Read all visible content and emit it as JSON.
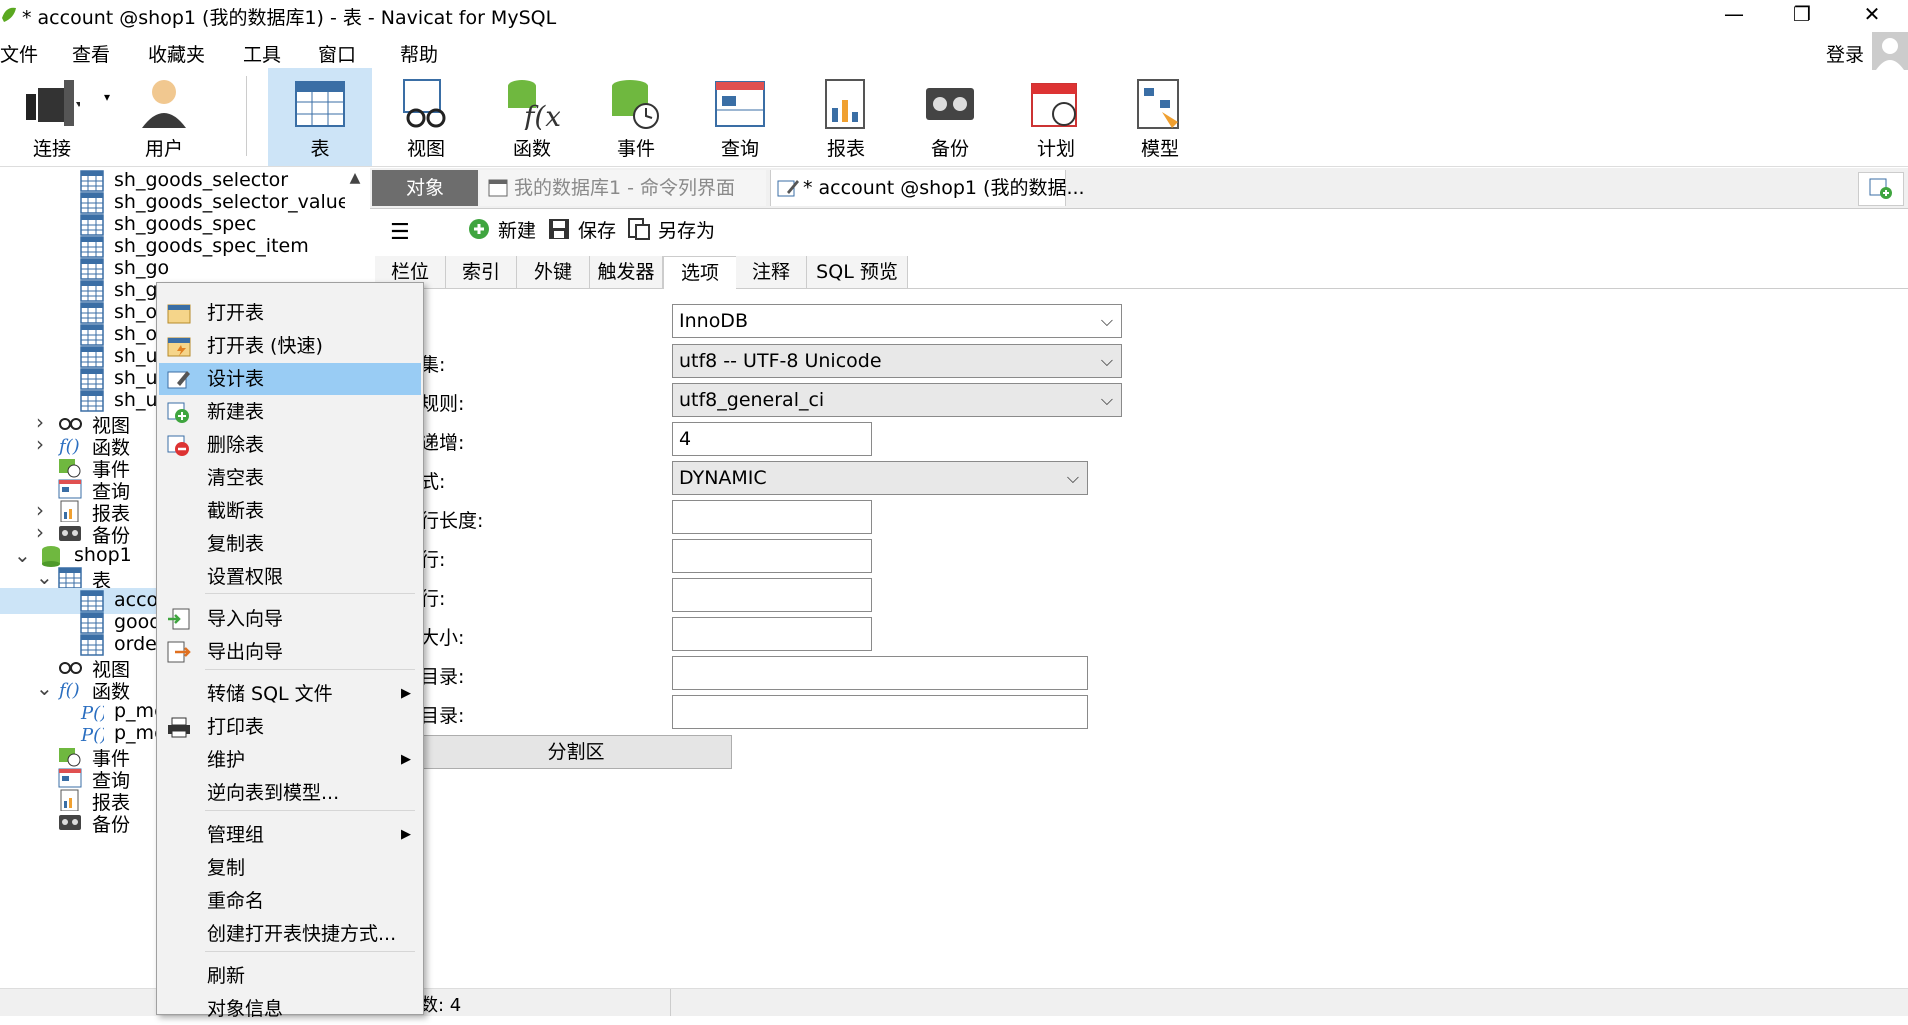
{
  "window": {
    "title": "* account @shop1 (我的数据库1) - 表 - Navicat for MySQL",
    "minimize": "—",
    "maximize": "❐",
    "close": "✕"
  },
  "menubar": {
    "items": [
      "文件",
      "查看",
      "收藏夹",
      "工具",
      "窗口",
      "帮助"
    ],
    "login": "登录"
  },
  "toolbar": {
    "items": [
      {
        "label": "连接",
        "icon": "plug-icon"
      },
      {
        "label": "用户",
        "icon": "user-icon"
      },
      {
        "label": "表",
        "icon": "table-icon"
      },
      {
        "label": "视图",
        "icon": "view-icon"
      },
      {
        "label": "函数",
        "icon": "function-icon"
      },
      {
        "label": "事件",
        "icon": "event-icon"
      },
      {
        "label": "查询",
        "icon": "query-icon"
      },
      {
        "label": "报表",
        "icon": "report-icon"
      },
      {
        "label": "备份",
        "icon": "backup-icon"
      },
      {
        "label": "计划",
        "icon": "schedule-icon"
      },
      {
        "label": "模型",
        "icon": "model-icon"
      }
    ]
  },
  "tree": {
    "items": [
      {
        "label": "sh_goods_selector",
        "icon": "table-icon"
      },
      {
        "label": "sh_goods_selector_value",
        "icon": "table-icon"
      },
      {
        "label": "sh_goods_spec",
        "icon": "table-icon"
      },
      {
        "label": "sh_goods_spec_item",
        "icon": "table-icon"
      },
      {
        "label": "sh_go",
        "icon": "table-icon"
      },
      {
        "label": "sh_go",
        "icon": "table-icon"
      },
      {
        "label": "sh_or",
        "icon": "table-icon"
      },
      {
        "label": "sh_or",
        "icon": "table-icon"
      },
      {
        "label": "sh_us",
        "icon": "table-icon"
      },
      {
        "label": "sh_us",
        "icon": "table-icon"
      },
      {
        "label": "sh_us",
        "icon": "table-icon"
      },
      {
        "label": "视图",
        "icon": "view-icon"
      },
      {
        "label": "函数",
        "icon": "function-icon"
      },
      {
        "label": "事件",
        "icon": "event-icon"
      },
      {
        "label": "查询",
        "icon": "query-icon"
      },
      {
        "label": "报表",
        "icon": "report-icon"
      },
      {
        "label": "备份",
        "icon": "backup-icon"
      },
      {
        "label": "shop1",
        "icon": "database-icon"
      },
      {
        "label": "表",
        "icon": "table-icon"
      },
      {
        "label": "acco",
        "icon": "table-icon"
      },
      {
        "label": "good",
        "icon": "table-icon"
      },
      {
        "label": "orde",
        "icon": "table-icon"
      },
      {
        "label": "视图",
        "icon": "view-icon"
      },
      {
        "label": "函数",
        "icon": "function-icon"
      },
      {
        "label": "p_mo",
        "icon": "procedure-icon"
      },
      {
        "label": "p_mo",
        "icon": "procedure-icon"
      },
      {
        "label": "事件",
        "icon": "event-icon"
      },
      {
        "label": "查询",
        "icon": "query-icon"
      },
      {
        "label": "报表",
        "icon": "report-icon"
      },
      {
        "label": "备份",
        "icon": "backup-icon"
      }
    ]
  },
  "tabs": {
    "objects": "对象",
    "cmd": "我的数据库1 - 命令列界面",
    "active": "* account @shop1 (我的数据..."
  },
  "editor_toolbar": {
    "new": "新建",
    "save": "保存",
    "save_as": "另存为"
  },
  "subtabs": [
    "栏位",
    "索引",
    "外键",
    "触发器",
    "选项",
    "注释",
    "SQL 预览"
  ],
  "form": {
    "labels": [
      "集:",
      "规则:",
      "递增:",
      "式:",
      "行长度:",
      "行:",
      "行:",
      "大小:",
      "目录:",
      "目录:"
    ],
    "engine": "InnoDB",
    "charset": "utf8 -- UTF-8 Unicode",
    "collation": "utf8_general_ci",
    "auto_increment": "4",
    "row_format": "DYNAMIC",
    "partition_button": "分割区"
  },
  "status": {
    "text": "数: 4"
  },
  "context_menu": {
    "items": [
      {
        "label": "打开表",
        "icon": "open-table-icon"
      },
      {
        "label": "打开表 (快速)",
        "icon": "open-table-fast-icon"
      },
      {
        "label": "设计表",
        "icon": "design-table-icon"
      },
      {
        "label": "新建表",
        "icon": "new-table-icon"
      },
      {
        "label": "删除表",
        "icon": "delete-table-icon"
      },
      {
        "label": "清空表"
      },
      {
        "label": "截断表"
      },
      {
        "label": "复制表"
      },
      {
        "label": "设置权限"
      },
      {
        "label": "导入向导",
        "icon": "import-icon"
      },
      {
        "label": "导出向导",
        "icon": "export-icon"
      },
      {
        "label": "转储 SQL 文件",
        "submenu": true
      },
      {
        "label": "打印表",
        "icon": "print-icon"
      },
      {
        "label": "维护",
        "submenu": true
      },
      {
        "label": "逆向表到模型..."
      },
      {
        "label": "管理组",
        "submenu": true
      },
      {
        "label": "复制"
      },
      {
        "label": "重命名"
      },
      {
        "label": "创建打开表快捷方式..."
      },
      {
        "label": "刷新"
      },
      {
        "label": "对象信息"
      }
    ]
  }
}
